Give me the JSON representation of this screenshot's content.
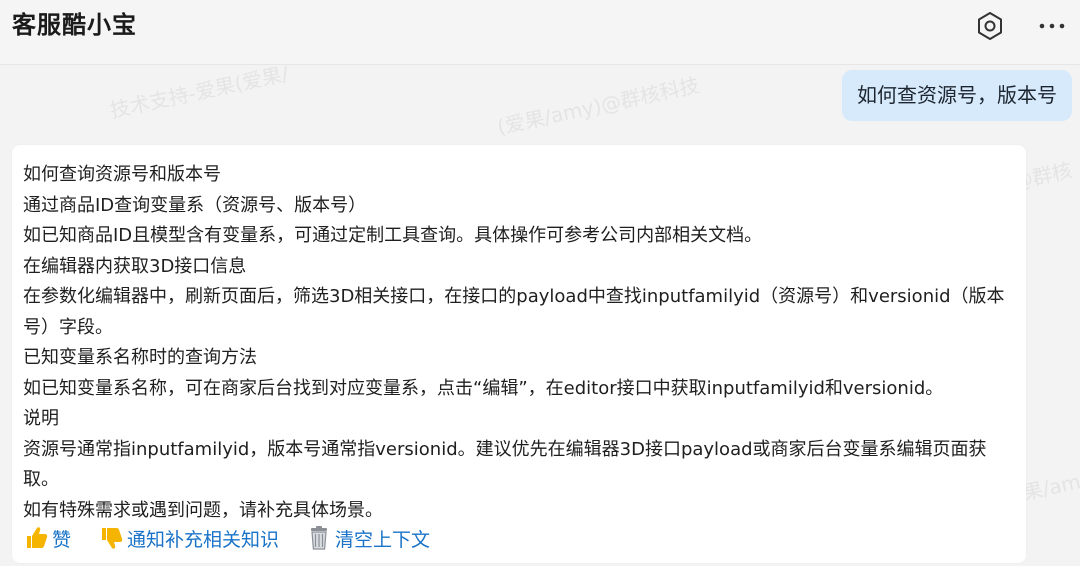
{
  "header": {
    "title": "客服酷小宝",
    "settings_icon": "hexagon-settings-icon",
    "more_icon": "more-horizontal-icon"
  },
  "watermarks": [
    "技术支持-爱果(爱果/",
    "(爱果/amy)@群核科技",
    "@群核",
    "果/amy"
  ],
  "user_message": "如何查资源号，版本号",
  "bot_response": {
    "lines": [
      "如何查询资源号和版本号",
      "通过商品ID查询变量系（资源号、版本号）",
      "如已知商品ID且模型含有变量系，可通过定制工具查询。具体操作可参考公司内部相关文档。",
      "在编辑器内获取3D接口信息",
      "在参数化编辑器中，刷新页面后，筛选3D相关接口，在接口的payload中查找inputfamilyid（资源号）和versionid（版本",
      "号）字段。",
      "已知变量系名称时的查询方法",
      "如已知变量系名称，可在商家后台找到对应变量系，点击“编辑”，在editor接口中获取inputfamilyid和versionid。",
      "说明",
      "资源号通常指inputfamilyid，版本号通常指versionid。建议优先在编辑器3D接口payload或商家后台变量系编辑页面获",
      "取。",
      "如有特殊需求或遇到问题，请补充具体场景。"
    ],
    "actions": {
      "like": {
        "label": "赞",
        "icon": "thumbs-up-icon"
      },
      "dislike": {
        "label": "通知补充相关知识",
        "icon": "thumbs-down-icon"
      },
      "clear": {
        "label": "清空上下文",
        "icon": "trash-icon"
      }
    }
  },
  "colors": {
    "background": "#f3f3f3",
    "user_bubble": "#d7eafb",
    "link": "#1a73c8",
    "thumb": "#f4b400"
  }
}
